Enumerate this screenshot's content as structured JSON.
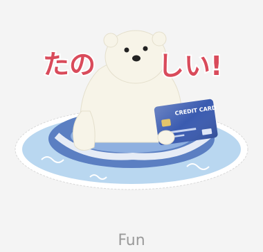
{
  "sticker": {
    "text_left": "たの",
    "text_right": "しい!",
    "card_label": "CREDIT CARD",
    "colors": {
      "background": "#f4f4f4",
      "title_text": "#d94b5b",
      "bear_fur": "#f7f4e8",
      "ring_blue": "#5b7fc2",
      "water": "#b9d7f0",
      "card_blue": "#3a5bb0"
    }
  },
  "caption": {
    "label": "Fun"
  }
}
